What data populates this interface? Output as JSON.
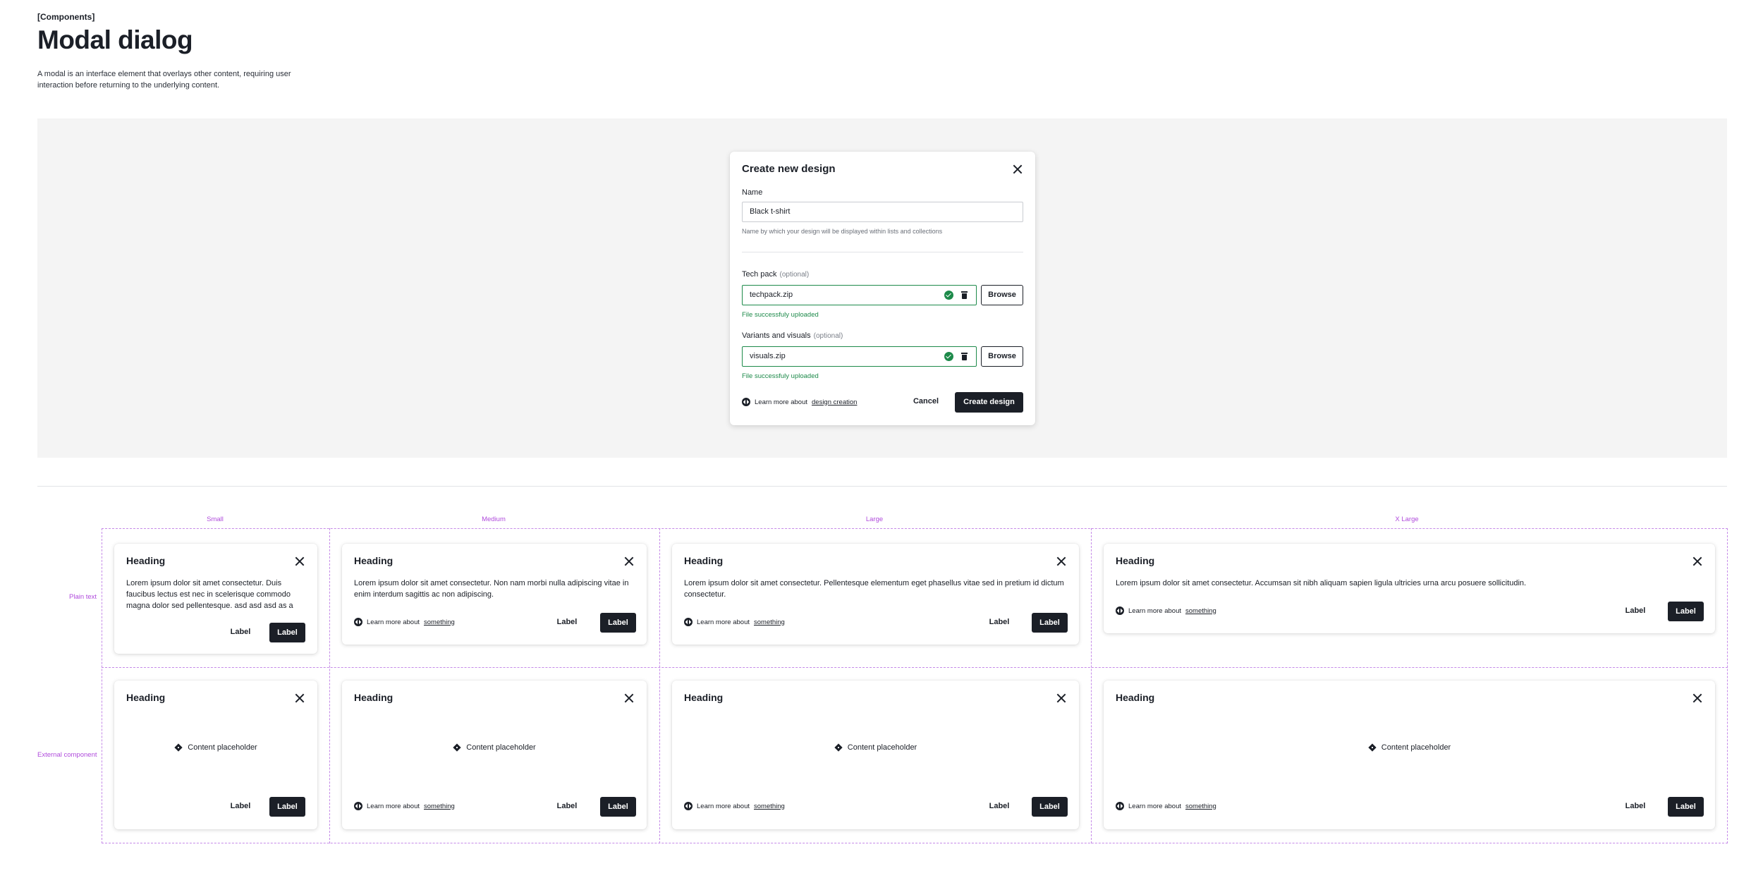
{
  "header": {
    "eyebrow": "[Components]",
    "title": "Modal dialog",
    "description": "A modal is an interface element that overlays other content, requiring user interaction before returning to the underlying content."
  },
  "dialog": {
    "title": "Create new design",
    "name_label": "Name",
    "name_value": "Black t-shirt",
    "name_help": "Name by which your design will be displayed within lists and collections",
    "techpack_label": "Tech pack",
    "optional": "(optional)",
    "techpack_value": "techpack.zip",
    "success": "File successfuly uploaded",
    "browse": "Browse",
    "visuals_label": "Variants and visuals",
    "visuals_value": "visuals.zip",
    "learn_prefix": "Learn more about",
    "learn_link": "design creation",
    "cancel": "Cancel",
    "create": "Create design"
  },
  "grid": {
    "columns": [
      "Small",
      "Medium",
      "Large",
      "X Large"
    ],
    "rows": [
      "Plain text",
      "External component"
    ]
  },
  "cards": {
    "heading": "Heading",
    "body_small": "Lorem ipsum dolor sit amet consectetur. Duis faucibus lectus est nec in scelerisque commodo magna dolor sed pellentesque. asd asd asd as  a",
    "body_medium": "Lorem ipsum dolor sit amet consectetur. Non nam morbi nulla adipiscing vitae in enim interdum sagittis ac non adipiscing.",
    "body_large": "Lorem ipsum dolor sit amet consectetur. Pellentesque elementum eget phasellus vitae sed in pretium id dictum consectetur.",
    "body_xlarge": "Lorem ipsum dolor sit amet consectetur. Accumsan sit nibh aliquam sapien ligula ultricies urna arcu posuere sollicitudin.",
    "placeholder": "Content placeholder",
    "learn_prefix": "Learn more about",
    "learn_link": "something",
    "secondary_label": "Label",
    "primary_label": "Label"
  }
}
